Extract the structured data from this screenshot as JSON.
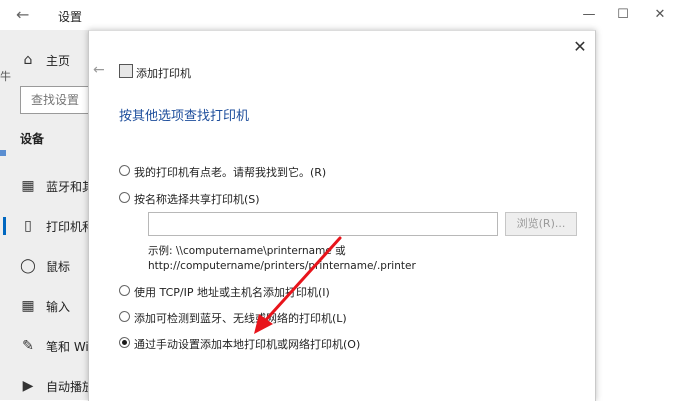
{
  "window": {
    "title": "设置",
    "back_icon": "arrow-left-icon",
    "controls": [
      "minimize-icon",
      "maximize-icon",
      "close-icon"
    ]
  },
  "sidebar": {
    "home_label": "主页",
    "search_placeholder": "查找设置",
    "group_label": "设备",
    "items": [
      {
        "label": "蓝牙和其",
        "icon": "keyboard-icon"
      },
      {
        "label": "打印机和",
        "icon": "printer-icon",
        "selected": true
      },
      {
        "label": "鼠标",
        "icon": "mouse-icon"
      },
      {
        "label": "输入",
        "icon": "keyboard-icon"
      },
      {
        "label": "笔和 Wi",
        "icon": "pen-icon"
      },
      {
        "label": "自动播放",
        "icon": "autoplay-icon"
      }
    ]
  },
  "dialog": {
    "title": "添加打印机",
    "heading": "按其他选项查找打印机",
    "options": [
      {
        "label": "我的打印机有点老。请帮我找到它。(R)",
        "selected": false
      },
      {
        "label": "按名称选择共享打印机(S)",
        "selected": false
      },
      {
        "label": "使用 TCP/IP 地址或主机名添加打印机(I)",
        "selected": false
      },
      {
        "label": "添加可检测到蓝牙、无线或网络的打印机(L)",
        "selected": false
      },
      {
        "label": "通过手动设置添加本地打印机或网络打印机(O)",
        "selected": true
      }
    ],
    "share_input_value": "",
    "browse_label": "浏览(R)...",
    "example_line1": "示例: \\\\computername\\printername 或",
    "example_line2": "http://computername/printers/printername/.printer"
  },
  "annotation": {
    "color": "#e8141b"
  }
}
